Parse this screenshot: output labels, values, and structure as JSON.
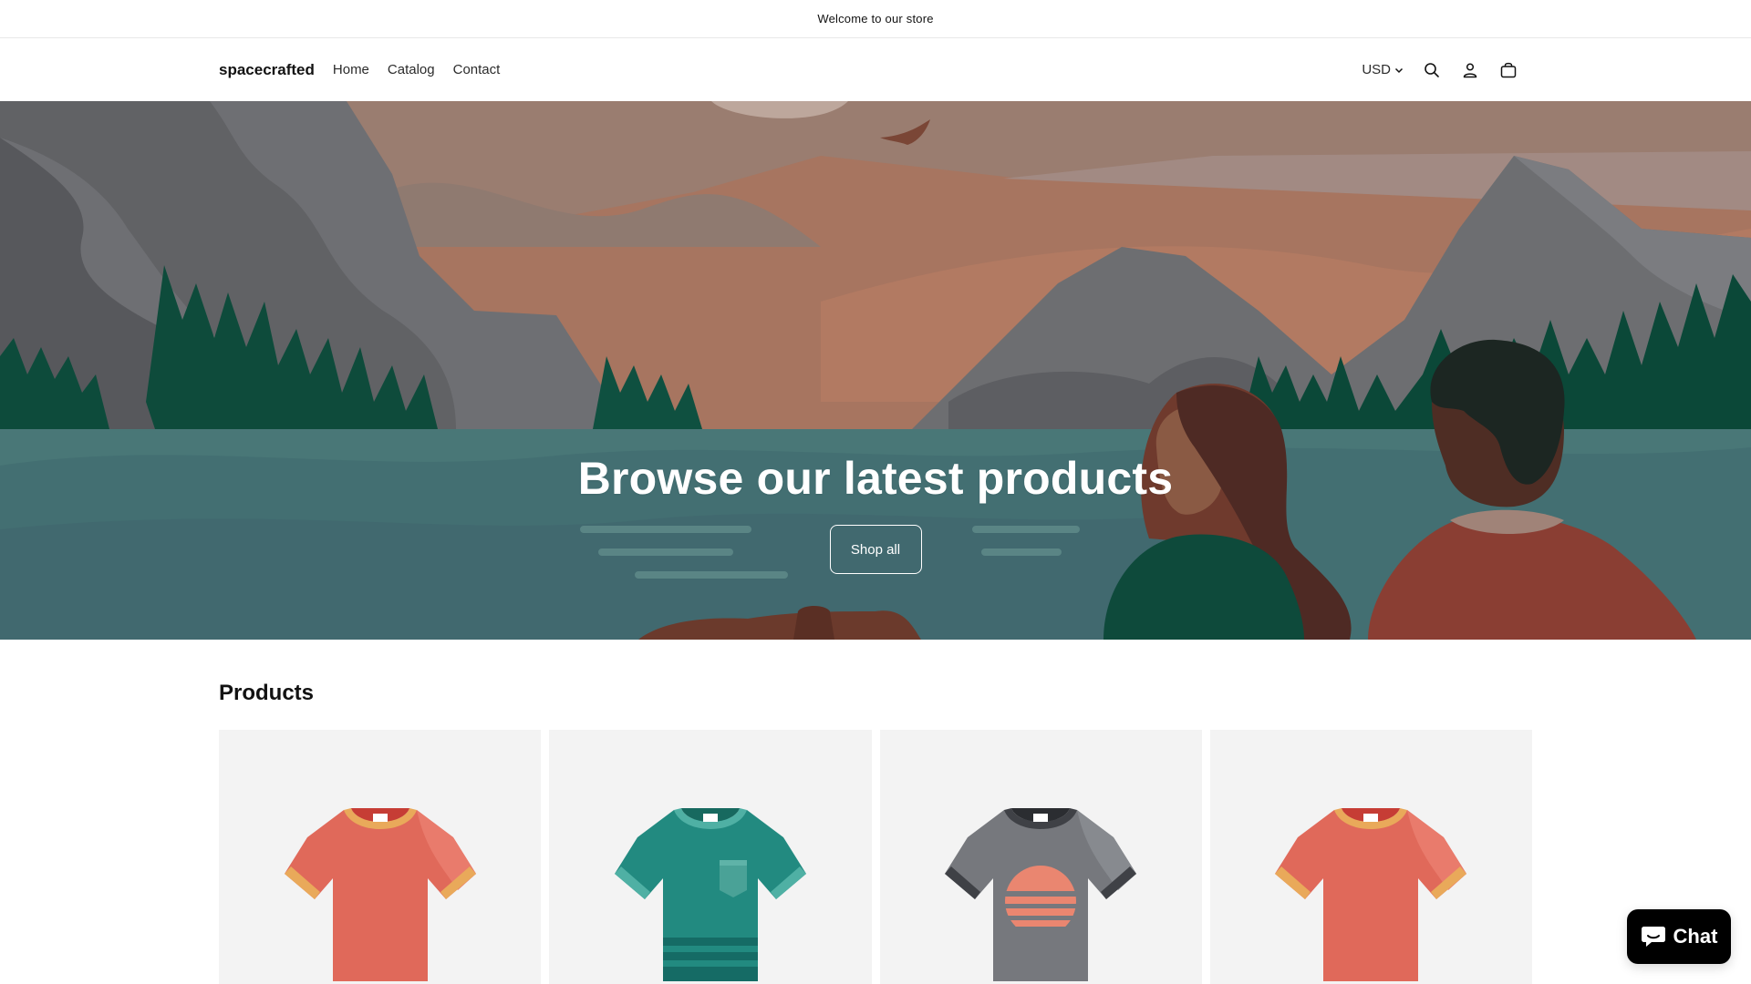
{
  "announcement": {
    "text": "Welcome to our store"
  },
  "header": {
    "logo": "spacecrafted",
    "nav": [
      {
        "label": "Home"
      },
      {
        "label": "Catalog"
      },
      {
        "label": "Contact"
      }
    ],
    "currency": "USD",
    "icons": [
      "search-icon",
      "account-icon",
      "cart-icon",
      "chevron-down-icon"
    ]
  },
  "hero": {
    "title": "Browse our latest products",
    "button_label": "Shop all"
  },
  "products": {
    "title": "Products",
    "items": [
      {
        "image": "orange-ringer-tshirt"
      },
      {
        "image": "teal-pocket-striped-tshirt"
      },
      {
        "image": "gray-sunset-tshirt"
      },
      {
        "image": "orange-ringer-tshirt"
      }
    ]
  },
  "chat": {
    "label": "Chat"
  },
  "colors": {
    "water": "#4a7777",
    "forest": "#0e4b3c",
    "mountain_gray": "#6e6f72",
    "sky_terracotta": "#a26b5a",
    "chat_bg": "#000000"
  }
}
